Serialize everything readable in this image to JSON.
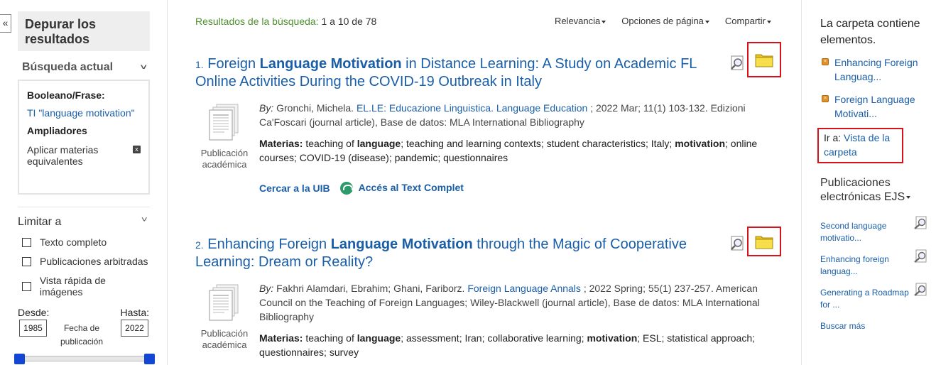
{
  "sidebar": {
    "collapse_label": "«",
    "refine_title": "Depurar los resultados",
    "current_search": {
      "heading": "Búsqueda actual",
      "boolean_label": "Booleano/Frase:",
      "term": "TI \"language motivation\"",
      "expanders_label": "Ampliadores",
      "expander": "Aplicar materias equivalentes",
      "remove_label": "x"
    },
    "limit": {
      "heading": "Limitar a",
      "options": [
        "Texto completo",
        "Publicaciones arbitradas",
        "Vista rápida de imágenes"
      ],
      "from_label": "Desde:",
      "to_label": "Hasta:",
      "from_value": "1985",
      "to_value": "2022",
      "date_label": "Fecha de publicación"
    }
  },
  "toolbar": {
    "results_label": "Resultados de la búsqueda:",
    "results_range": "1 a 10 de 78",
    "relevance": "Relevancia",
    "page_options": "Opciones de página",
    "share": "Compartir"
  },
  "results": [
    {
      "number": "1.",
      "title_a": "Foreign ",
      "title_b": "Language Motivation",
      "title_c": " in Distance Learning: A Study on Academic FL Online Activities During the COVID-19 Outbreak in Italy",
      "pub_type": "Publicación académica",
      "by_label": "By:",
      "author": "Gronchi, Michela.",
      "source": "EL.LE: Educazione Linguistica. Language Education",
      "meta_rest": "; 2022 Mar; 11(1) 103-132. Edizioni Ca'Foscari (journal article), Base de datos: MLA International Bibliography",
      "subjects_label": "Materias:",
      "subjects_1": "teaching of",
      "subjects_b1": "language",
      "subjects_2": "; teaching and learning contexts; student characteristics; Italy;",
      "subjects_b2": "motivation",
      "subjects_3": "; online courses; COVID-19 (disease); pandemic; questionnaires",
      "link_1": "Cercar a la UIB",
      "link_2": "Accés al Text Complet"
    },
    {
      "number": "2.",
      "title_a": "Enhancing Foreign ",
      "title_b": "Language Motivation",
      "title_c": " through the Magic of Cooperative Learning: Dream or Reality?",
      "pub_type": "Publicación académica",
      "by_label": "By:",
      "author": "Fakhri Alamdari, Ebrahim; Ghani, Fariborz.",
      "source": "Foreign Language Annals",
      "meta_rest": "; 2022 Spring; 55(1) 237-257. American Council on the Teaching of Foreign Languages; Wiley-Blackwell (journal article), Base de datos: MLA International Bibliography",
      "subjects_label": "Materias:",
      "subjects_1": "teaching of",
      "subjects_b1": "language",
      "subjects_2": "; assessment; Iran; collaborative learning;",
      "subjects_b2": "motivation",
      "subjects_3": "; ESL; statistical approach; questionnaires; survey"
    }
  ],
  "folder": {
    "title": "La carpeta contiene elementos.",
    "items": [
      "Enhancing Foreign Languag...",
      "Foreign Language Motivati..."
    ],
    "goto_label": "Ir a:",
    "goto_link": "Vista de la carpeta"
  },
  "ejs": {
    "heading": "Publicaciones electrónicas EJS",
    "items": [
      "Second language motivatio...",
      "Enhancing foreign languag...",
      "Generating a Roadmap for ..."
    ],
    "more": "Buscar más"
  },
  "colors": {
    "link": "#1a5ea8",
    "highlight_border": "#d8121b",
    "slider_handle": "#1446d6",
    "results_label": "#4d8f2e"
  }
}
